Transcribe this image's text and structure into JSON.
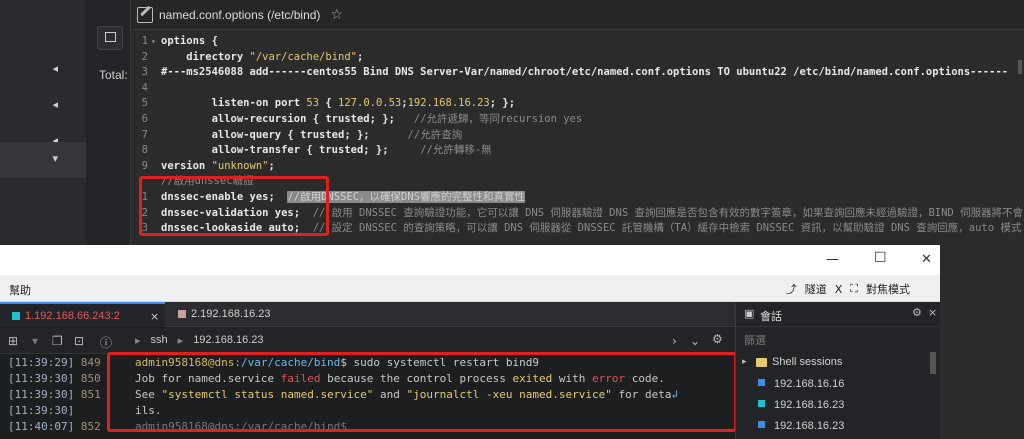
{
  "left_nav": {
    "total_label": "Total:"
  },
  "editor": {
    "file_title": "named.conf.options (/etc/bind)",
    "lines": [
      {
        "n": "1",
        "fold": "▾",
        "parts": [
          [
            "t",
            "options {"
          ]
        ]
      },
      {
        "n": "2",
        "fold": "",
        "parts": [
          [
            "t",
            "    directory "
          ],
          [
            "s",
            "\"/var/cache/bind\""
          ],
          [
            "t",
            ";"
          ]
        ]
      },
      {
        "n": "3",
        "fold": "",
        "parts": [
          [
            "t",
            "#---ms2546088 add------centos55 Bind DNS Server-Var/named/chroot/etc/named.conf.options TO ubuntu22 /etc/bind/named.conf.options------"
          ]
        ]
      },
      {
        "n": "4",
        "fold": "",
        "parts": []
      },
      {
        "n": "5",
        "fold": "",
        "parts": [
          [
            "t",
            "        listen-on port "
          ],
          [
            "n",
            "53"
          ],
          [
            "t",
            " { "
          ],
          [
            "n",
            "127.0.0.53"
          ],
          [
            "t",
            ";"
          ],
          [
            "n",
            "192.168.16.23"
          ],
          [
            "t",
            "; };"
          ]
        ]
      },
      {
        "n": "6",
        "fold": "",
        "parts": [
          [
            "t",
            "        allow-recursion { trusted; };   "
          ],
          [
            "c",
            "//允許遞歸，等同recursion yes"
          ]
        ]
      },
      {
        "n": "7",
        "fold": "",
        "parts": [
          [
            "t",
            "        allow-query { trusted; };      "
          ],
          [
            "c",
            "//允許查詢"
          ]
        ]
      },
      {
        "n": "8",
        "fold": "",
        "parts": [
          [
            "t",
            "        allow-transfer { trusted; };     "
          ],
          [
            "c",
            "//允許轉移-無"
          ]
        ]
      },
      {
        "n": "9",
        "fold": "",
        "parts": [
          [
            "t",
            "version "
          ],
          [
            "s",
            "\"unknown\""
          ],
          [
            "t",
            ";"
          ]
        ]
      },
      {
        "n": "",
        "fold": "",
        "parts": [
          [
            "c",
            "//啟用dnssec驗證"
          ]
        ]
      },
      {
        "n": "1",
        "fold": "",
        "parts": [
          [
            "t",
            "dnssec-enable yes;  "
          ],
          [
            "h",
            "//啟用DNSSEC，以確保DNS響應的完整性和真實性"
          ]
        ]
      },
      {
        "n": "2",
        "fold": "",
        "parts": [
          [
            "t",
            "dnssec-validation yes;  "
          ],
          [
            "c",
            "// 啟用 DNSSEC 查詢驗證功能，它可以讓 DNS 伺服器驗證 DNS 查詢回應是否包含有效的數字簽章，如果查詢回應未經過驗證，BIND 伺服器將不會"
          ]
        ]
      },
      {
        "n": "3",
        "fold": "",
        "parts": [
          [
            "t",
            "dnssec-lookaside auto;  "
          ],
          [
            "c",
            "// 設定 DNSSEC 的查詢策略，可以讓 DNS 伺服器從 DNSSEC 託管機構（TA）緩存中檢索 DNSSEC 資訊，以幫助驗證 DNS 查詢回應，auto 模式"
          ]
        ]
      }
    ]
  },
  "terminal": {
    "menu_help": "幫助",
    "menu_tunnel": "隧道",
    "menu_x": "X",
    "menu_fullscreen": "對焦模式",
    "tab1_label": "1.192.168.66.243:2",
    "tab2_label": "2.192.168.16.23",
    "toolbar_ssh": "ssh",
    "toolbar_host": "192.168.16.23",
    "rows": [
      {
        "time": "[11:39:29]",
        "num": "849"
      },
      {
        "time": "[11:39:30]",
        "num": "850"
      },
      {
        "time": "[11:39:30]",
        "num": "851"
      },
      {
        "time": "[11:39:30]",
        "num": ""
      },
      {
        "time": "[11:40:07]",
        "num": "852"
      }
    ],
    "prompt_user": "admin958168@dns",
    "prompt_path": ":/var/cache/bind",
    "prompt_cmd": "$ sudo systemctl restart bind9",
    "err_1a": "Job for named.service ",
    "err_1b": "failed",
    "err_1c": " because the control process ",
    "err_1d": "exited",
    "err_1e": " with ",
    "err_1f": "error",
    "err_1g": " code.",
    "err_2a": "See ",
    "err_2b": "\"systemctl status named.service\"",
    "err_2c": " and ",
    "err_2d": "\"journalctl -xeu named.service\"",
    "err_2e": " for deta",
    "err_3": "ils.",
    "last_line": "admin958168@dns:/var/cache/bind$"
  },
  "sessions": {
    "title": "會話",
    "filter_placeholder": "篩選",
    "group_label": "Shell sessions",
    "items": [
      {
        "label": "192.168.16.16",
        "color": "#3a8ee6"
      },
      {
        "label": "192.168.16.23",
        "color": "#20c0d0"
      },
      {
        "label": "192.168.16.23",
        "color": "#3a8ee6"
      }
    ]
  }
}
